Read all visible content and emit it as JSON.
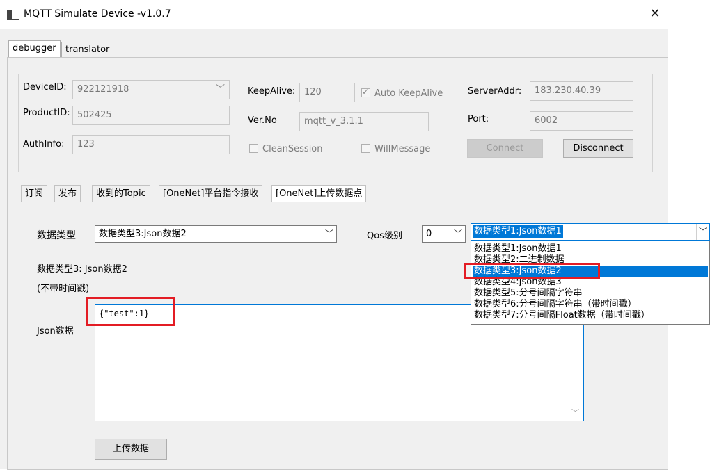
{
  "window": {
    "title": "MQTT Simulate Device  -v1.0.7",
    "close_symbol": "✕"
  },
  "main_tabs": [
    {
      "label": "debugger",
      "active": true
    },
    {
      "label": "translator",
      "active": false
    }
  ],
  "connection": {
    "device_id_label": "DeviceID:",
    "device_id": "922121918",
    "product_id_label": "ProductID:",
    "product_id": "502425",
    "auth_info_label": "AuthInfo:",
    "auth_info": "123",
    "keepalive_label": "KeepAlive:",
    "keepalive": "120",
    "auto_keepalive_label": "Auto KeepAlive",
    "auto_keepalive_checked": true,
    "ver_no_label": "Ver.No",
    "ver_no": "mqtt_v_3.1.1",
    "clean_session_label": "CleanSession",
    "clean_session_checked": false,
    "will_message_label": "WillMessage",
    "will_message_checked": false,
    "server_addr_label": "ServerAddr:",
    "server_addr": "183.230.40.39",
    "port_label": "Port:",
    "port": "6002",
    "connect_label": "Connect",
    "disconnect_label": "Disconnect"
  },
  "inner_tabs": [
    {
      "label": "订阅",
      "active": false
    },
    {
      "label": "发布",
      "active": false
    },
    {
      "label": "收到的Topic",
      "active": false
    },
    {
      "label": "[OneNet]平台指令接收",
      "active": false
    },
    {
      "label": "[OneNet]上传数据点",
      "active": true
    }
  ],
  "upload": {
    "data_type_label": "数据类型",
    "data_type_value": "数据类型3:Json数据2",
    "qos_label": "Qos级别",
    "qos_value": "0",
    "desc_line1": "数据类型3: Json数据2",
    "desc_line2": "(不带时间戳)",
    "json_label": "Json数据",
    "json_value": "{\"test\":1}",
    "upload_button": "上传数据"
  },
  "dropdown": {
    "current": "数据类型1:Json数据1",
    "options": [
      "数据类型1:Json数据1",
      "数据类型2:二进制数据",
      "数据类型3:Json数据2",
      "数据类型4:Json数据3",
      "数据类型5:分号间隔字符串",
      "数据类型6:分号间隔字符串（带时间戳）",
      "数据类型7:分号间隔Float数据（带时间戳）"
    ],
    "highlighted_index": 2
  },
  "colors": {
    "accent": "#0078d7",
    "highlight_box": "#e31c24"
  },
  "icons": {
    "dropdown_arrow": "﹀",
    "close": "✕"
  }
}
